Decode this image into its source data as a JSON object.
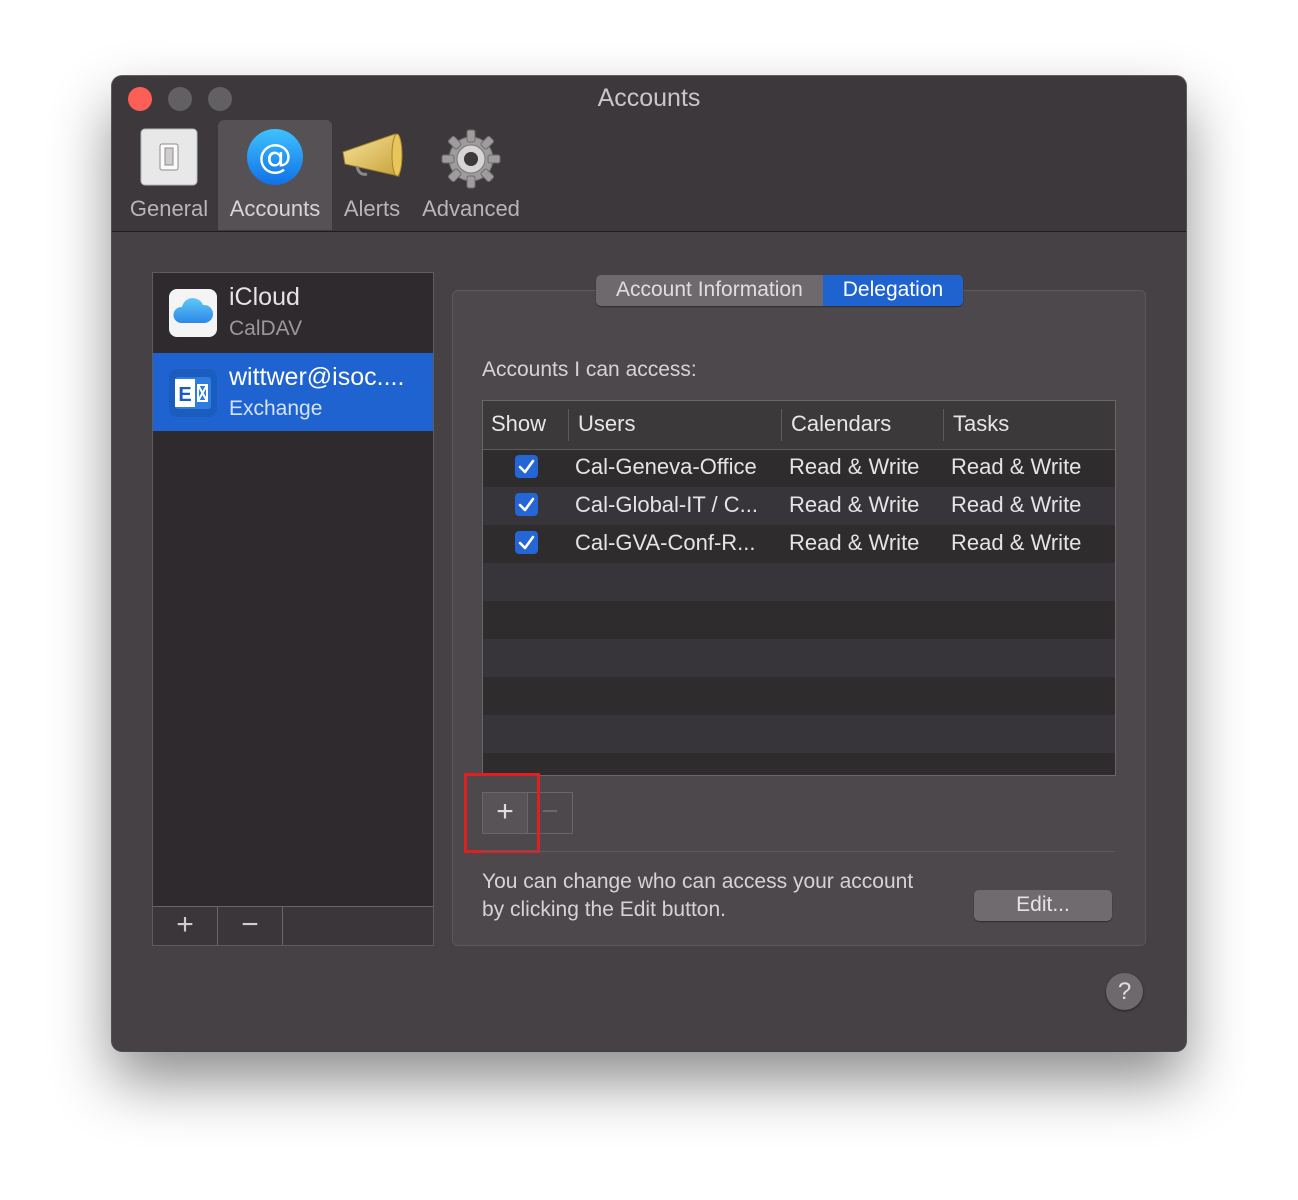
{
  "window": {
    "title": "Accounts"
  },
  "toolbar": {
    "items": [
      {
        "label": "General",
        "icon": "switch-icon"
      },
      {
        "label": "Accounts",
        "icon": "at-icon"
      },
      {
        "label": "Alerts",
        "icon": "megaphone-icon"
      },
      {
        "label": "Advanced",
        "icon": "gear-icon"
      }
    ],
    "selected": "Accounts"
  },
  "sidebar": {
    "accounts": [
      {
        "name": "iCloud",
        "type": "CalDAV",
        "icon": "icloud-icon"
      },
      {
        "name": "wittwer@isoc....",
        "type": "Exchange",
        "icon": "exchange-icon",
        "selected": true
      }
    ],
    "add_label": "+",
    "remove_label": "−"
  },
  "tabs": {
    "items": [
      "Account Information",
      "Delegation"
    ],
    "active": "Delegation"
  },
  "delegation": {
    "section_label": "Accounts I can access:",
    "columns": [
      "Show",
      "Users",
      "Calendars",
      "Tasks"
    ],
    "rows": [
      {
        "show": true,
        "user": "Cal-Geneva-Office",
        "calendars": "Read & Write",
        "tasks": "Read & Write"
      },
      {
        "show": true,
        "user": "Cal-Global-IT / C...",
        "calendars": "Read & Write",
        "tasks": "Read & Write"
      },
      {
        "show": true,
        "user": "Cal-GVA-Conf-R...",
        "calendars": "Read & Write",
        "tasks": "Read & Write"
      }
    ],
    "add_label": "+",
    "remove_label": "−",
    "description": "You can change who can access your account by clicking the Edit button.",
    "edit_label": "Edit..."
  },
  "help_label": "?",
  "colors": {
    "accent": "#1f63d1",
    "window_bg": "#454144",
    "highlight": "#e02020"
  }
}
